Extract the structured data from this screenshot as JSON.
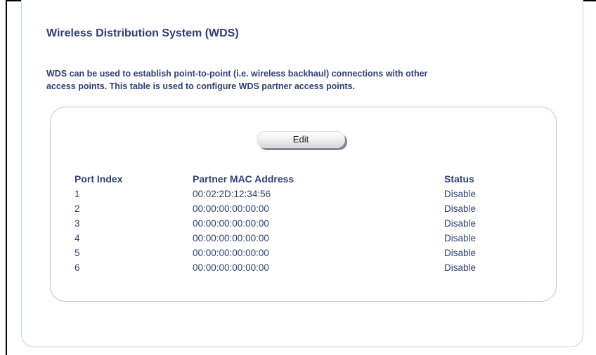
{
  "page": {
    "title": "Wireless Distribution System (WDS)",
    "description_line1": "WDS can be used to establish point-to-point (i.e. wireless backhaul) connections with other",
    "description_line2": "access points. This table is used to configure WDS partner access points."
  },
  "edit_button": {
    "label": "Edit"
  },
  "table": {
    "headers": {
      "port_index": "Port Index",
      "partner_mac": "Partner MAC Address",
      "status": "Status"
    },
    "rows": [
      {
        "port": "1",
        "mac": "00:02:2D:12:34:56",
        "status": "Disable"
      },
      {
        "port": "2",
        "mac": "00:00:00:00:00:00",
        "status": "Disable"
      },
      {
        "port": "3",
        "mac": "00:00:00:00:00:00",
        "status": "Disable"
      },
      {
        "port": "4",
        "mac": "00:00:00:00:00:00",
        "status": "Disable"
      },
      {
        "port": "5",
        "mac": "00:00:00:00:00:00",
        "status": "Disable"
      },
      {
        "port": "6",
        "mac": "00:00:00:00:00:00",
        "status": "Disable"
      }
    ]
  },
  "colors": {
    "text": "#2f3f74",
    "panel_border": "#b7c4dc"
  }
}
